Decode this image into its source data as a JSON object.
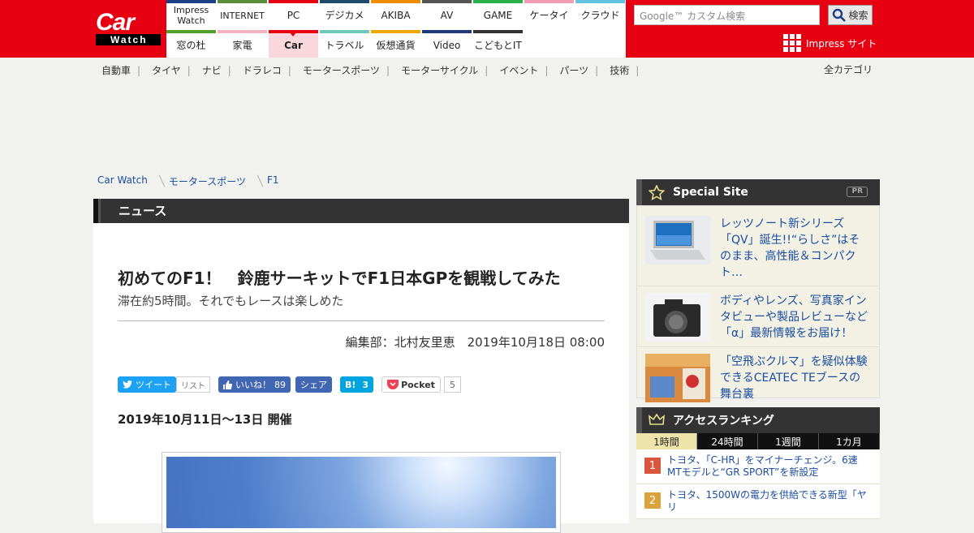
{
  "header": {
    "logo_main": "Car",
    "logo_sub": "Watch",
    "nav_row1": [
      {
        "label": "Impress\nWatch",
        "color": "#1a3f86"
      },
      {
        "label": "INTERNET",
        "color": "#5b8e3c"
      },
      {
        "label": "PC",
        "color": "#e60012"
      },
      {
        "label": "デジカメ",
        "color": "#1e4a6e"
      },
      {
        "label": "AKIBA",
        "color": "#f08c00"
      },
      {
        "label": "AV",
        "color": "#555555"
      },
      {
        "label": "GAME",
        "color": "#2bb24c"
      },
      {
        "label": "ケータイ",
        "color": "#f29cb4"
      },
      {
        "label": "クラウド",
        "color": "#63c3e0"
      }
    ],
    "nav_row2": [
      {
        "label": "窓の杜",
        "color": "#4fa12a"
      },
      {
        "label": "家電",
        "color": "#f4b3c0"
      },
      {
        "label": "Car",
        "color": "#e60012",
        "active": true
      },
      {
        "label": "トラベル",
        "color": "#6fc8b9"
      },
      {
        "label": "仮想通貨",
        "color": "#f0a800"
      },
      {
        "label": "Video",
        "color": "#1e3a78"
      },
      {
        "label": "こどもとIT",
        "color": "#333333"
      }
    ],
    "search_placeholder": "Google™ カスタム検索",
    "search_button": "検索",
    "impress_site": "Impress サイト"
  },
  "categories": [
    "自動車",
    "タイヤ",
    "ナビ",
    "ドラレコ",
    "モータースポーツ",
    "モーターサイクル",
    "イベント",
    "パーツ",
    "技術"
  ],
  "all_categories": "全カテゴリ",
  "breadcrumb": [
    "Car Watch",
    "モータースポーツ",
    "F1"
  ],
  "article": {
    "section": "ニュース",
    "title": "初めてのF1！　鈴鹿サーキットでF1日本GPを観戦してみた",
    "subtitle": "滞在約5時間。それでもレースは楽しめた",
    "byline": "編集部：北村友里恵　2019年10月18日 08:00",
    "event_date": "2019年10月11日～13日 開催",
    "share": {
      "tweet": "ツイート",
      "list": "リスト",
      "like": "いいね！",
      "like_count": "89",
      "share": "シェア",
      "hatena": "B!",
      "hatena_count": "3",
      "pocket": "Pocket",
      "pocket_count": "5"
    }
  },
  "special_site": {
    "title": "Special Site",
    "pr": "PR",
    "items": [
      {
        "text": "レッツノート新シリーズ「QV」誕生!!“らしさ”はそのまま、高性能＆コンパクト…"
      },
      {
        "text": "ボディやレンズ、写真家インタビューや製品レビューなど「α」最新情報をお届け！"
      },
      {
        "text": "「空飛ぶクルマ」を疑似体験できるCEATEC TEブースの舞台裏"
      }
    ]
  },
  "ranking": {
    "title": "アクセスランキング",
    "tabs": [
      "1時間",
      "24時間",
      "1週間",
      "1カ月"
    ],
    "items": [
      {
        "rank": "1",
        "text": "トヨタ、「C-HR」をマイナーチェンジ。6速MTモデルと“GR SPORT”を新設定",
        "color": "#d9573c"
      },
      {
        "rank": "2",
        "text": "トヨタ、1500Wの電力を供給できる新型「ヤリ",
        "color": "#d9a23c"
      }
    ]
  }
}
